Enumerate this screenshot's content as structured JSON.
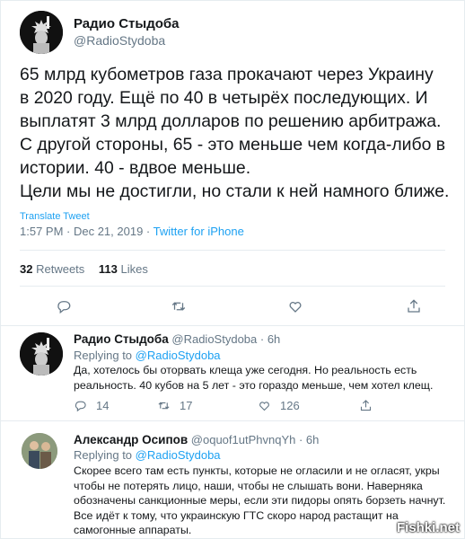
{
  "main_tweet": {
    "author_name": "Радио Стыдоба",
    "author_handle": "@RadioStydoba",
    "text_lines": [
      "65 млрд кубометров газа прокачают через Украину",
      "в 2020 году. Ещё по 40 в четырёх последующих. И",
      "выплатят 3 млрд долларов по решению арбитража.",
      "С другой стороны, 65 - это меньше чем когда-либо в",
      "истории. 40 - вдвое меньше.",
      "Цели мы не достигли, но стали к ней намного ближе."
    ],
    "translate_label": "Translate Tweet",
    "timestamp": "1:57 PM · Dec 21, 2019 ·",
    "source": "Twitter for iPhone",
    "retweets_count": "32",
    "retweets_label": "Retweets",
    "likes_count": "113",
    "likes_label": "Likes"
  },
  "reply1": {
    "author_name": "Радио Стыдоба",
    "author_handle": "@RadioStydoba",
    "time": "· 6h",
    "replying_prefix": "Replying to",
    "replying_handle": "@RadioStydoba",
    "text_lines": [
      "Да, хотелось бы оторвать клеща уже сегодня. Но реальность есть",
      "реальность. 40 кубов на 5 лет - это гораздо меньше, чем хотел клещ."
    ],
    "replies": "14",
    "retweets": "17",
    "likes": "126"
  },
  "reply2": {
    "author_name": "Александр Осипов",
    "author_handle": "@oquof1utPhvnqYh",
    "time": "· 6h",
    "replying_prefix": "Replying to",
    "replying_handle": "@RadioStydoba",
    "text_lines": [
      "Скорее всего там есть пункты, которые не огласили и не огласят, укры",
      "чтобы не потерять лицо, наши, чтобы не слышать вони. Наверняка",
      "обозначены санкционные меры, если эти пидоры опять борзеть начнут.",
      "Все идёт к тому, что украинскую ГТС скоро народ растащит на",
      "самогонные аппараты."
    ]
  },
  "watermark": "Fishki.net",
  "colors": {
    "accent": "#1da1f2",
    "muted": "#657786",
    "text": "#14171a",
    "divider": "#e6ecf0"
  }
}
